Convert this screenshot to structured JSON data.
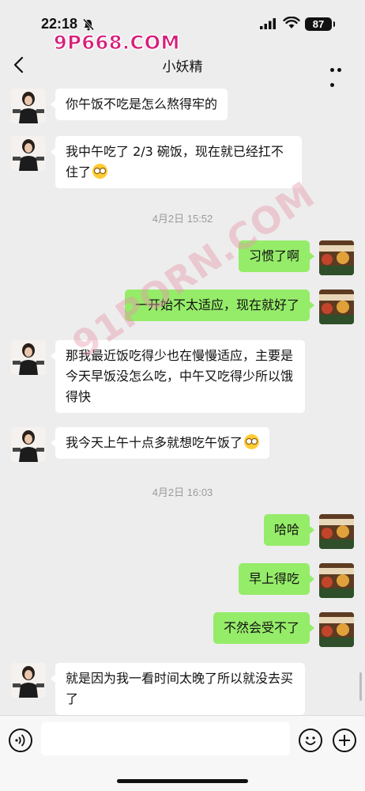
{
  "status_bar": {
    "time": "22:18",
    "battery": "87",
    "icons": [
      "bell-mute-icon",
      "signal-icon",
      "wifi-icon",
      "battery-icon"
    ]
  },
  "watermarks": {
    "top": "9P668.COM",
    "middle": "91PORN.COM"
  },
  "nav": {
    "title": "小妖精",
    "back_icon": "chevron-left-icon",
    "more_icon": "more-dots-icon"
  },
  "timestamps": [
    "4月2日 15:52",
    "4月2日 16:03"
  ],
  "messages": [
    {
      "sender": "her",
      "text": "你午饭不吃是怎么熬得牢的"
    },
    {
      "sender": "her",
      "text": "我中午吃了 2/3 碗饭，现在就已经扛不住了",
      "emoji": "dizzy-face-emoji"
    },
    {
      "sender": "me",
      "text": "习惯了啊"
    },
    {
      "sender": "me",
      "text": "一开始不太适应，现在就好了"
    },
    {
      "sender": "her",
      "text": "那我最近饭吃得少也在慢慢适应，主要是今天早饭没怎么吃，中午又吃得少所以饿得快"
    },
    {
      "sender": "her",
      "text": "我今天上午十点多就想吃午饭了",
      "emoji": "dizzy-face-emoji"
    },
    {
      "sender": "me",
      "text": "哈哈"
    },
    {
      "sender": "me",
      "text": "早上得吃"
    },
    {
      "sender": "me",
      "text": "不然会受不了"
    },
    {
      "sender": "her",
      "text": "就是因为我一看时间太晚了所以就没去买了"
    }
  ],
  "input_bar": {
    "input_value": "",
    "icons": [
      "voice-icon",
      "emoji-icon",
      "plus-icon"
    ]
  },
  "colors": {
    "background": "#ededed",
    "bubble_me": "#95ec69",
    "bubble_her": "#ffffff",
    "watermark_top": "#d81f7a"
  }
}
